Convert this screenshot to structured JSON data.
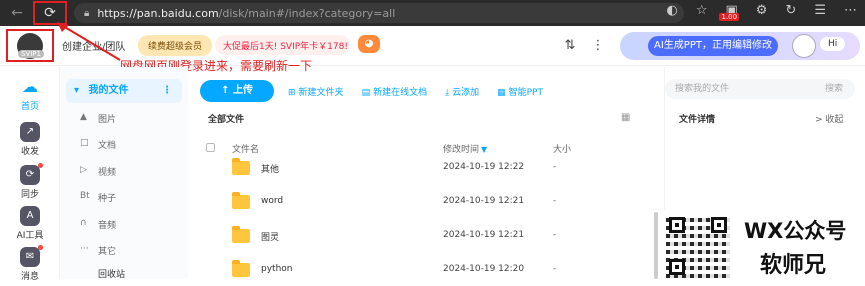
{
  "browser": {
    "url_host": "https://pan.baidu.com",
    "url_path": "/disk/main#/index?category=all",
    "ext_badge": "1.00"
  },
  "header": {
    "avatar_tag": "SVIP1",
    "enterprise_label": "创建企业/团队",
    "renew_label": "续费超级会员",
    "promo_label": "大促最后1天! SVIP年卡￥178!",
    "ai_button_label": "AI生成PPT，正用编辑修改",
    "ai_hi": "Hi"
  },
  "annotation": {
    "text": "网盘网页刚登录进来，需要刷新一下",
    "color": "#e02020"
  },
  "left_nav": {
    "items": [
      {
        "label": "首页",
        "icon": "cloud-icon"
      },
      {
        "label": "收发",
        "icon": "send-icon"
      },
      {
        "label": "同步",
        "icon": "sync-icon"
      },
      {
        "label": "AI工具",
        "icon": "ai-icon"
      },
      {
        "label": "消息",
        "icon": "message-icon"
      }
    ]
  },
  "categories": {
    "active": "我的文件",
    "items": [
      {
        "label": "图片",
        "icon": "▲"
      },
      {
        "label": "文档",
        "icon": "□"
      },
      {
        "label": "视频",
        "icon": "▷"
      },
      {
        "label": "种子",
        "icon": "Bt"
      },
      {
        "label": "音频",
        "icon": "∩"
      },
      {
        "label": "其它",
        "icon": "···"
      }
    ],
    "recycle": "回收站"
  },
  "toolbar": {
    "upload": "上传",
    "new_folder": "新建文件夹",
    "new_doc": "新建在线文档",
    "cloud_add": "云添加",
    "smart_ppt": "智能PPT"
  },
  "main": {
    "section_title": "全部文件",
    "columns": {
      "name": "文件名",
      "modified": "修改时间",
      "size": "大小"
    },
    "rows": [
      {
        "name": "其他",
        "date": "2024-10-19 12:22",
        "size": "-"
      },
      {
        "name": "word",
        "date": "2024-10-19 12:21",
        "size": "-"
      },
      {
        "name": "图灵",
        "date": "2024-10-19 12:21",
        "size": "-"
      },
      {
        "name": "python",
        "date": "2024-10-19 12:20",
        "size": "-"
      }
    ]
  },
  "right_panel": {
    "search_placeholder": "搜索我的文件",
    "search_btn": "搜索",
    "detail_title": "文件详情",
    "collapse": "收起"
  },
  "watermark": {
    "line1": "WX公众号",
    "line2": "软师兄"
  }
}
